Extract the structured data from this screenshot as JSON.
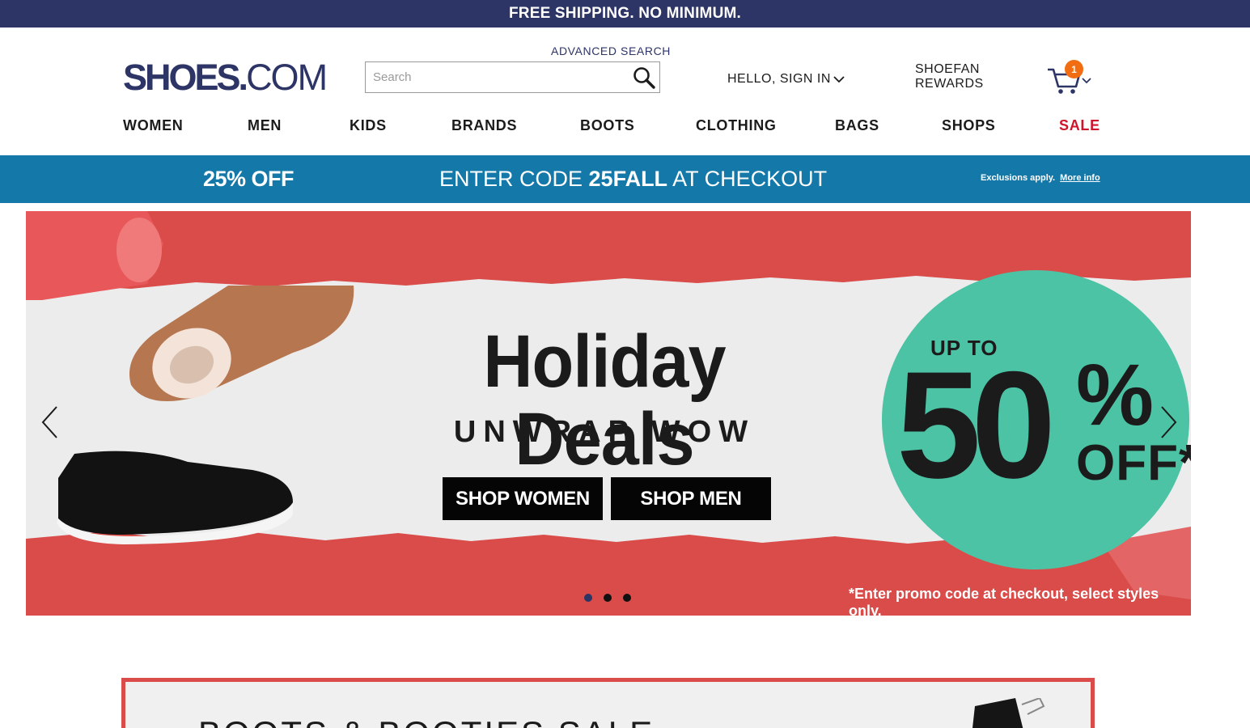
{
  "topbar": {
    "text": "FREE SHIPPING. NO MINIMUM."
  },
  "header": {
    "logo_bold": "SHOES",
    "logo_thin": "COM",
    "advanced_search": "ADVANCED SEARCH",
    "search_placeholder": "Search",
    "search_value": "",
    "signin": "HELLO, SIGN IN",
    "rewards_line1": "SHOEFAN",
    "rewards_line2": "REWARDS",
    "cart_count": "1",
    "icons": [
      "search-icon",
      "chevron-down-icon",
      "cart-icon"
    ]
  },
  "nav": {
    "items": [
      "WOMEN",
      "MEN",
      "KIDS",
      "BRANDS",
      "BOOTS",
      "CLOTHING",
      "BAGS",
      "SHOPS",
      "SALE"
    ],
    "sale_color": "#d0142c"
  },
  "promo": {
    "off": "25% OFF",
    "code_prefix": "ENTER CODE ",
    "code": "25FALL",
    "code_suffix": " AT CHECKOUT",
    "exclusions": "Exclusions apply.",
    "more_info": "More info",
    "bg_color": "#1478a9"
  },
  "hero": {
    "title": "Holiday Deals",
    "subtitle": "UNWRAP WOW",
    "btn_women": "SHOP WOMEN",
    "btn_men": "SHOP MEN",
    "up_to": "UP TO",
    "percent_number": "50",
    "percent_sign": "%",
    "off": "OFF*",
    "disclaimer": "*Enter promo code at checkout, select styles only.",
    "slide_count": 3,
    "active_slide": 1,
    "accent_red": "#d94c4a",
    "accent_teal": "#4bc3a4"
  },
  "boots_banner": {
    "title": "BOOTS & BOOTIES SALE"
  }
}
